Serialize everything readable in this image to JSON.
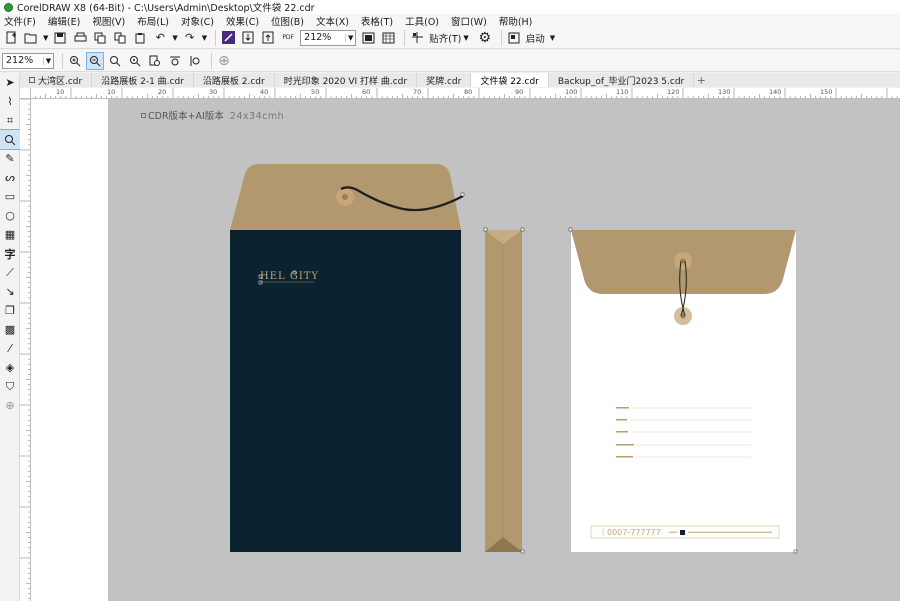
{
  "window": {
    "title": "CorelDRAW X8 (64-Bit) - C:\\Users\\Admin\\Desktop\\文件袋 22.cdr"
  },
  "menu": [
    "文件(F)",
    "编辑(E)",
    "视图(V)",
    "布局(L)",
    "对象(C)",
    "效果(C)",
    "位图(B)",
    "文本(X)",
    "表格(T)",
    "工具(O)",
    "窗口(W)",
    "帮助(H)"
  ],
  "toolbar": {
    "zoom_value": "212%",
    "snap_label": "贴齐(T)",
    "launch_label": "启动",
    "pdf_label": "PDF"
  },
  "propbar": {
    "zoom_value": "212%"
  },
  "tabs": [
    {
      "label": "大湾区.cdr",
      "active": false
    },
    {
      "label": "沿路展板 2-1 曲.cdr",
      "active": false
    },
    {
      "label": "沿路展板 2.cdr",
      "active": false
    },
    {
      "label": "时光印象 2020 VI 打样 曲.cdr",
      "active": false
    },
    {
      "label": "奖牌.cdr",
      "active": false
    },
    {
      "label": "文件袋 22.cdr",
      "active": true
    },
    {
      "label": "Backup_of_毕业门2023 5.cdr",
      "active": false
    }
  ],
  "ruler_h_labels": [
    "10",
    "0",
    "10",
    "20",
    "30",
    "40",
    "50",
    "60",
    "70",
    "80",
    "90",
    "100",
    "110",
    "120",
    "130",
    "140",
    "150"
  ],
  "canvas": {
    "caption_main": "CDR版本+AI版本",
    "caption_sub": "24x34cmh"
  },
  "design": {
    "brand_name": "HEL GITY",
    "phone": "0007-777777",
    "colors": {
      "kraft": "#b1986f",
      "navy": "#0b2231",
      "page_white": "#ffffff",
      "canvas_gray": "#c2c2c2",
      "gold": "#c8a870"
    }
  }
}
